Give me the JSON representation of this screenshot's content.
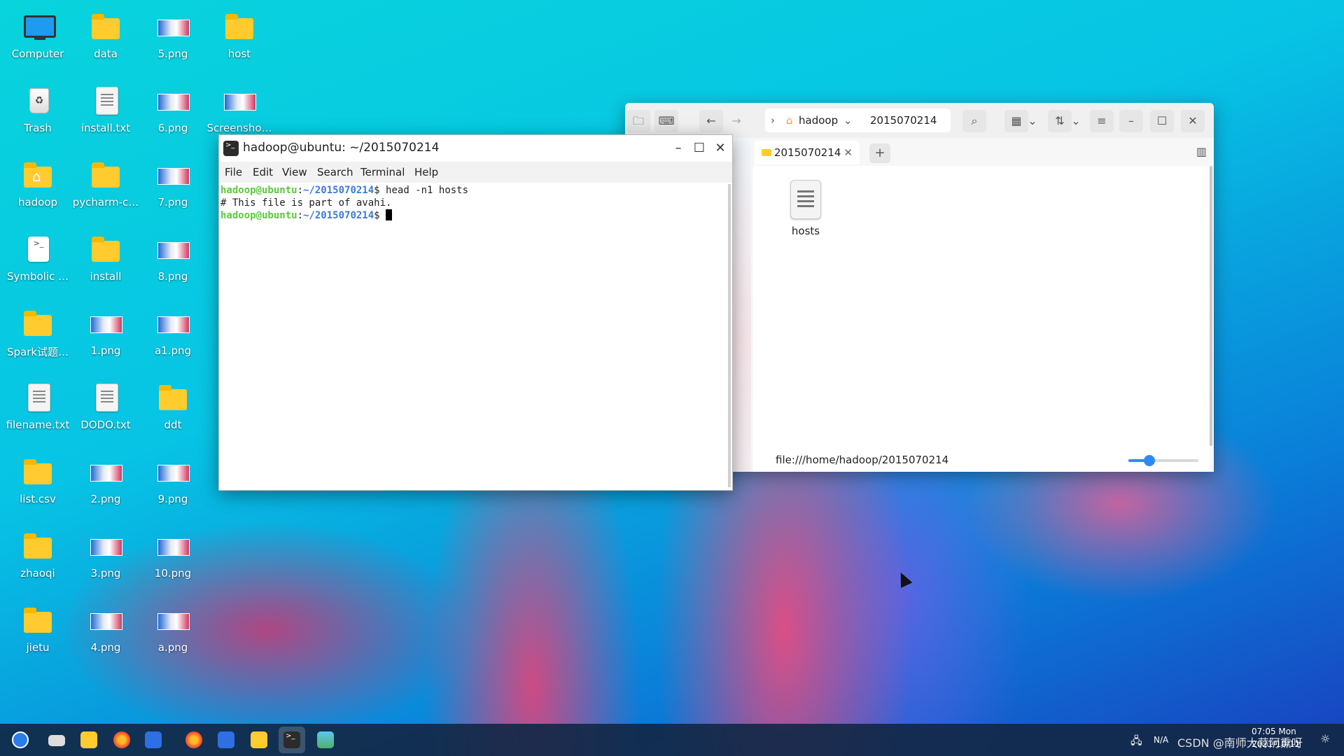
{
  "desktop": {
    "icons": [
      {
        "label": "Computer",
        "type": "computer"
      },
      {
        "label": "data",
        "type": "folder"
      },
      {
        "label": "5.png",
        "type": "png"
      },
      {
        "label": "host",
        "type": "folder"
      },
      {
        "label": "Trash",
        "type": "trash"
      },
      {
        "label": "install.txt",
        "type": "doc"
      },
      {
        "label": "6.png",
        "type": "png"
      },
      {
        "label": "Screensho…",
        "type": "png"
      },
      {
        "label": "hadoop",
        "type": "home-folder"
      },
      {
        "label": "pycharm-c…",
        "type": "folder"
      },
      {
        "label": "7.png",
        "type": "png"
      },
      {
        "label": "Symbolic …",
        "type": "symlink"
      },
      {
        "label": "install",
        "type": "folder"
      },
      {
        "label": "8.png",
        "type": "png"
      },
      {
        "label": "Spark试题…",
        "type": "folder"
      },
      {
        "label": "1.png",
        "type": "png"
      },
      {
        "label": "a1.png",
        "type": "png"
      },
      {
        "label": "filename.txt",
        "type": "doc"
      },
      {
        "label": "DODO.txt",
        "type": "doc"
      },
      {
        "label": "ddt",
        "type": "folder"
      },
      {
        "label": "list.csv",
        "type": "folder"
      },
      {
        "label": "2.png",
        "type": "png"
      },
      {
        "label": "9.png",
        "type": "png"
      },
      {
        "label": "zhaoqi",
        "type": "folder"
      },
      {
        "label": "3.png",
        "type": "png"
      },
      {
        "label": "10.png",
        "type": "png"
      },
      {
        "label": "jietu",
        "type": "folder"
      },
      {
        "label": "4.png",
        "type": "png"
      },
      {
        "label": "a.png",
        "type": "png"
      }
    ]
  },
  "terminal": {
    "title": "hadoop@ubuntu: ~/2015070214",
    "menu": [
      "File",
      "Edit",
      "View",
      "Search",
      "Terminal",
      "Help"
    ],
    "lines": [
      {
        "user": "hadoop@ubuntu",
        "path": "~/2015070214",
        "cmd": "$ head -n1 hosts"
      },
      {
        "output": "# This file is part of avahi."
      },
      {
        "user": "hadoop@ubuntu",
        "path": "~/2015070214",
        "cmd": "$ "
      }
    ]
  },
  "file_manager": {
    "breadcrumb": [
      "hadoop",
      "2015070214"
    ],
    "tab_label": "2015070214",
    "files": [
      {
        "name": "hosts",
        "type": "text"
      }
    ],
    "status_path": "file:///home/hadoop/2015070214",
    "zoom_level": 0.25
  },
  "taskbar": {
    "apps": [
      "start-menu",
      "multitask-view",
      "file-manager",
      "firefox",
      "wps-writer",
      "firefox",
      "wps-writer",
      "file-manager",
      "terminal",
      "image-viewer"
    ],
    "active_app": "terminal",
    "tray": {
      "network_label": "N/A",
      "watermark": "CSDN @南师大蒜阿熏呀",
      "time": "07:05 Mon",
      "date": "2021/10/11"
    }
  },
  "colors": {
    "prompt_user": "#5ac93e",
    "prompt_path": "#3d7bd6",
    "accent": "#2f8af5",
    "folder": "#ffcb2e"
  }
}
